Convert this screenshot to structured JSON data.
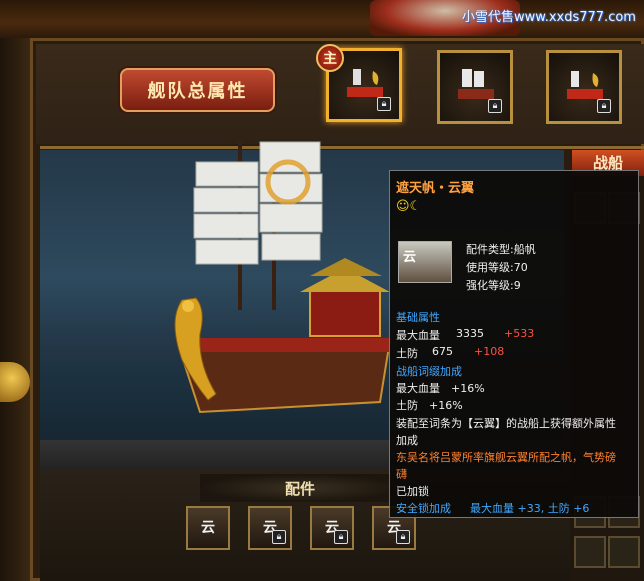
{
  "watermark": "小雪代售www.xxds777.com",
  "fleet_button_label": "舰队总属性",
  "main_badge": "主",
  "right_tab_label": "战船",
  "parts_title": "配件",
  "ship_slots": [
    {
      "locked": true,
      "active": true
    },
    {
      "locked": true,
      "active": false
    },
    {
      "locked": true,
      "active": false
    }
  ],
  "part_slots": [
    {
      "glyph": "云",
      "locked": false
    },
    {
      "glyph": "云",
      "locked": true
    },
    {
      "glyph": "云",
      "locked": true
    },
    {
      "glyph": "云",
      "locked": true
    }
  ],
  "tooltip": {
    "title": "遮天帆・云翼",
    "status_icons": "☺☾",
    "icon_label": "云",
    "part_type": "配件类型:船帆",
    "use_level": "使用等级:70",
    "enhance_level": "强化等级:9",
    "base_attr_header": "基础属性",
    "max_hp_label": "最大血量",
    "max_hp_value": "3335",
    "max_hp_bonus": "+533",
    "defense_label": "土防",
    "defense_value": "675",
    "defense_bonus": "+108",
    "affix_header": "战船词缀加成",
    "affix_hp": "最大血量　+16%",
    "affix_def": "土防　+16%",
    "desc_line1": "装配至词条为【云翼】的战船上获得额外属性",
    "desc_line2": "加成",
    "lore_line1": "东吴名将吕蒙所率旗舰云翼所配之帆，气势磅",
    "lore_line2": "礴",
    "locked_text": "已加锁",
    "safe_lock_label": "安全锁加成",
    "safe_lock_value": "最大血量 +33, 土防 +6"
  },
  "colors": {
    "tooltip_title": "#ffa040",
    "bonus": "#ff5040",
    "header": "#40a8ff",
    "lore": "#ff8030"
  }
}
